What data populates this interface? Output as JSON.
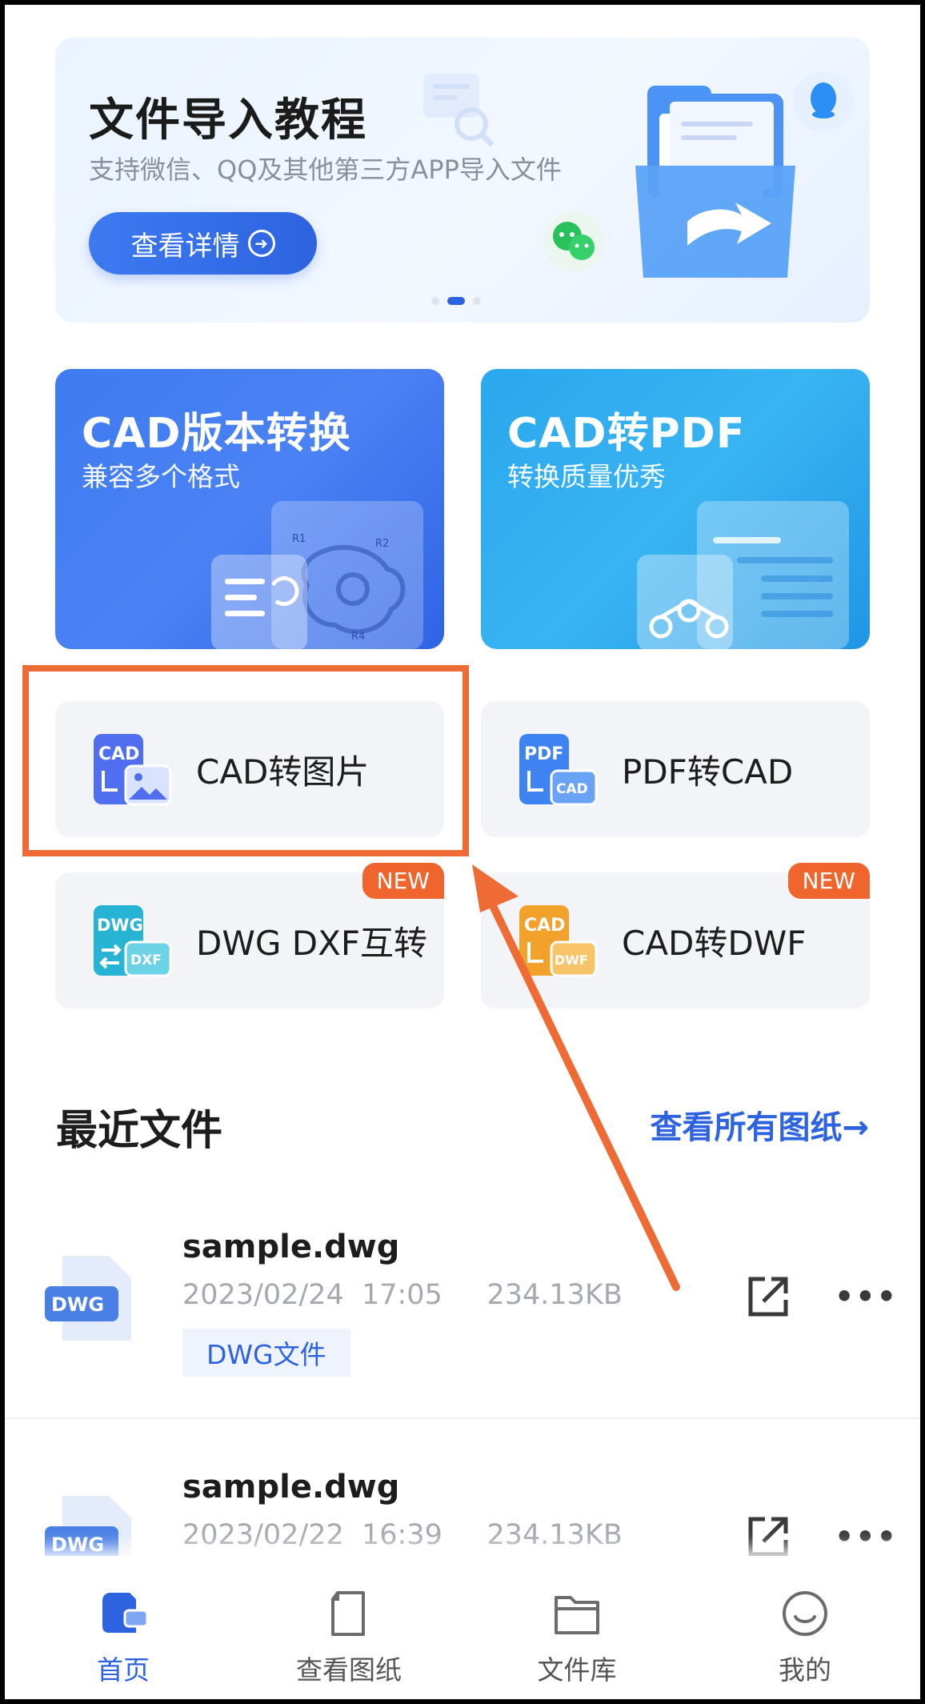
{
  "banner": {
    "title": "文件导入教程",
    "subtitle": "支持微信、QQ及其他第三方APP导入文件",
    "button_label": "查看详情"
  },
  "feature_cards": [
    {
      "title": "CAD版本转换",
      "subtitle": "兼容多个格式"
    },
    {
      "title": "CAD转PDF",
      "subtitle": "转换质量优秀"
    }
  ],
  "tools": [
    {
      "label": "CAD转图片",
      "icon_top": "CAD"
    },
    {
      "label": "PDF转CAD",
      "icon_top": "PDF",
      "icon_bottom": "CAD"
    },
    {
      "label": "DWG DXF互转",
      "icon_top": "DWG",
      "icon_bottom": "DXF",
      "badge": "NEW"
    },
    {
      "label": "CAD转DWF",
      "icon_top": "CAD",
      "icon_bottom": "DWF",
      "badge": "NEW"
    }
  ],
  "recent": {
    "title": "最近文件",
    "see_all": "查看所有图纸→",
    "files": [
      {
        "name": "sample.dwg",
        "meta": "2023/02/24  17:05     234.13KB",
        "tag": "DWG文件",
        "icon_text": "DWG"
      },
      {
        "name": "sample.dwg",
        "meta": "2023/02/22  16:39     234.13KB",
        "icon_text": "DWG"
      }
    ]
  },
  "nav": [
    {
      "label": "首页",
      "icon": "home-icon",
      "active": true
    },
    {
      "label": "查看图纸",
      "icon": "drawing-icon"
    },
    {
      "label": "文件库",
      "icon": "folder-icon"
    },
    {
      "label": "我的",
      "icon": "profile-icon"
    }
  ],
  "colors": {
    "accent": "#2d63e0",
    "highlight": "#ee6b35",
    "badge": "#f0652d"
  }
}
